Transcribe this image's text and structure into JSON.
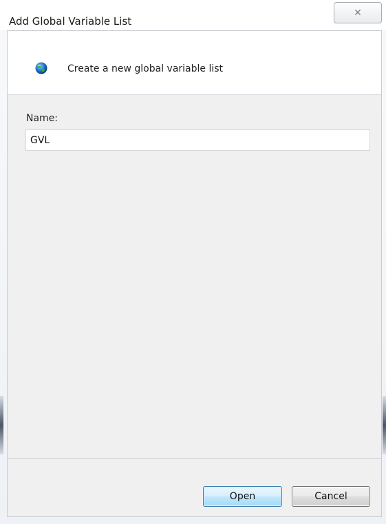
{
  "window": {
    "title": "Add Global Variable List",
    "close_glyph": "✕"
  },
  "header": {
    "icon": "globe-icon",
    "text": "Create a new global variable list"
  },
  "form": {
    "name_label": "Name:",
    "name_value": "GVL"
  },
  "buttons": {
    "open_label": "Open",
    "cancel_label": "Cancel"
  },
  "colors": {
    "default_button_border": "#3c7fb1",
    "dialog_background": "#f0f0f0"
  }
}
